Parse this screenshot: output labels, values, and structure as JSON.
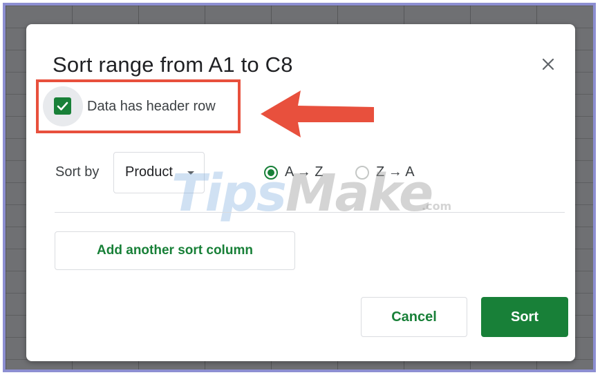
{
  "dialog": {
    "title": "Sort range from A1 to C8",
    "close_icon": "close-icon",
    "header_checkbox": {
      "label": "Data has header row",
      "checked": true
    },
    "sort_by": {
      "label": "Sort by",
      "column": "Product",
      "options": [
        {
          "label": "A → Z",
          "selected": true
        },
        {
          "label": "Z → A",
          "selected": false
        }
      ]
    },
    "add_column_label": "Add another sort column",
    "cancel_label": "Cancel",
    "sort_label": "Sort"
  },
  "watermark": {
    "part1": "Tips",
    "part2": "Make",
    "suffix": ".com"
  },
  "colors": {
    "accent": "#188038",
    "annotation": "#e8503d",
    "frame": "#8d8fd2"
  }
}
